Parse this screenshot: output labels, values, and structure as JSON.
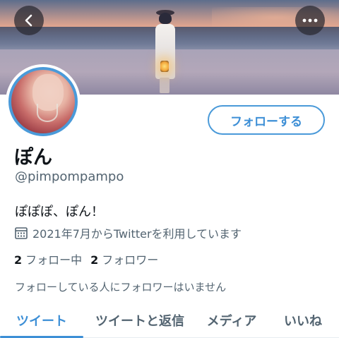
{
  "profile": {
    "display_name": "ぽん",
    "handle": "@pimpompampo",
    "bio": "ぽぽぽ、ぽん！",
    "joined": "2021年7月からTwitterを利用しています",
    "following_count": "2",
    "following_label": "フォロー中",
    "followers_count": "2",
    "followers_label": "フォロワー",
    "followers_note": "フォローしている人にフォロワーはいません"
  },
  "actions": {
    "follow_label": "フォローする",
    "back_icon": "chevron-left-icon",
    "more_icon": "more-horizontal-icon"
  },
  "tabs": [
    {
      "label": "ツイート",
      "active": true
    },
    {
      "label": "ツイートと返信",
      "active": false
    },
    {
      "label": "メディア",
      "active": false
    },
    {
      "label": "いいね",
      "active": false
    }
  ],
  "colors": {
    "accent": "#3d8fd6",
    "avatar_ring": "#4a9ad9",
    "secondary_text": "#536471",
    "primary_text": "#0f1419"
  }
}
